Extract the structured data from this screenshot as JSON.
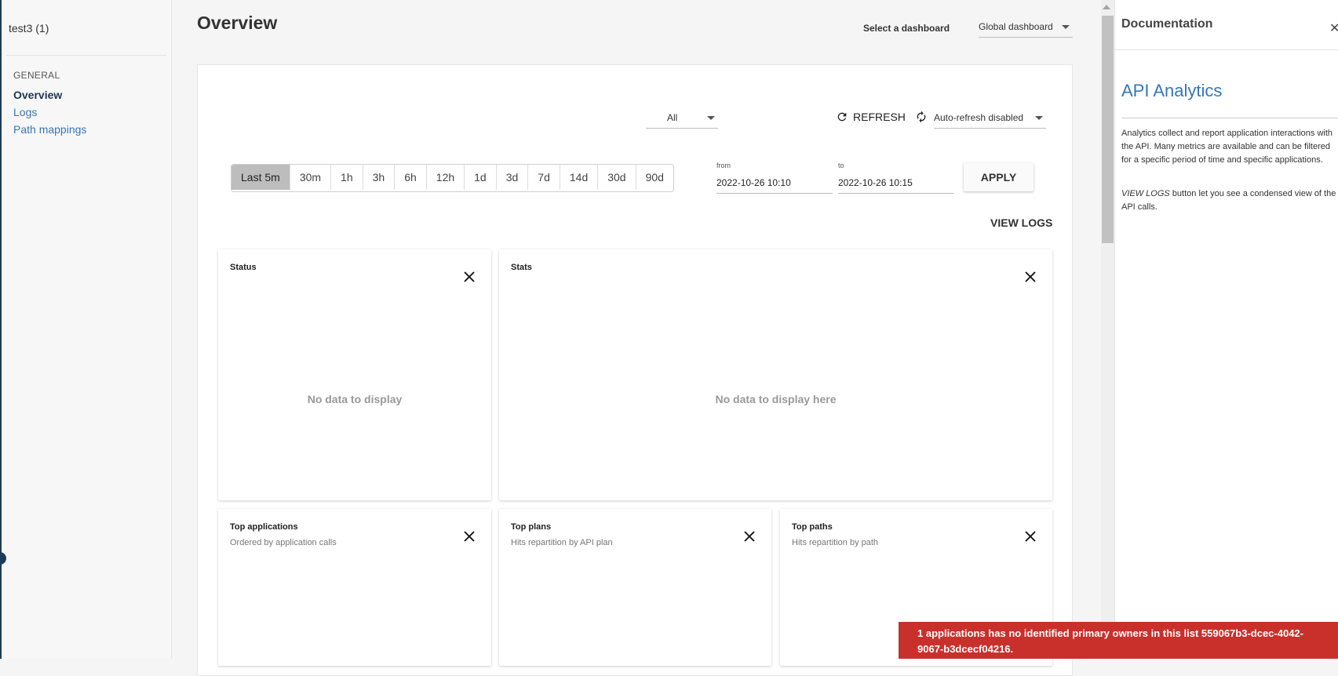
{
  "sidebar": {
    "project": "test3 (1)",
    "section": "GENERAL",
    "items": [
      {
        "label": "Overview",
        "active": true
      },
      {
        "label": "Logs"
      },
      {
        "label": "Path mappings"
      }
    ]
  },
  "header": {
    "title": "Overview",
    "select_label": "Select a dashboard",
    "dashboard_value": "Global dashboard"
  },
  "toolbar": {
    "filter_value": "All",
    "refresh_label": "REFRESH",
    "autorefresh_value": "Auto-refresh disabled"
  },
  "timeframe": {
    "ranges": [
      "Last 5m",
      "30m",
      "1h",
      "3h",
      "6h",
      "12h",
      "1d",
      "3d",
      "7d",
      "14d",
      "30d",
      "90d"
    ],
    "active": "Last 5m",
    "from_label": "from",
    "from_value": "2022-10-26 10:10",
    "to_label": "to",
    "to_value": "2022-10-26 10:15",
    "apply_label": "APPLY",
    "view_logs_label": "VIEW LOGS"
  },
  "widgets": {
    "status": {
      "title": "Status",
      "empty": "No data to display"
    },
    "stats": {
      "title": "Stats",
      "empty": "No data to display here"
    },
    "top_applications": {
      "title": "Top applications",
      "subtitle": "Ordered by application calls"
    },
    "top_plans": {
      "title": "Top plans",
      "subtitle": "Hits repartition by API plan"
    },
    "top_paths": {
      "title": "Top paths",
      "subtitle": "Hits repartition by path"
    }
  },
  "doc": {
    "title": "Documentation",
    "heading": "API Analytics",
    "p1": "Analytics collect and report application interactions with the API. Many metrics are available and can be filtered for a specific period of time and specific applications.",
    "p2_em": "VIEW LOGS",
    "p2_rest": " button let you see a condensed view of the API calls."
  },
  "toast": {
    "message": "1 applications has no identified primary owners in this list 559067b3-dcec-4042-9067-b3dcecf04216."
  },
  "colors": {
    "link": "#3577b7",
    "nav_dark": "#1f3a56",
    "toast_bg": "#c9302c",
    "active_range": "#bdbdbd"
  }
}
